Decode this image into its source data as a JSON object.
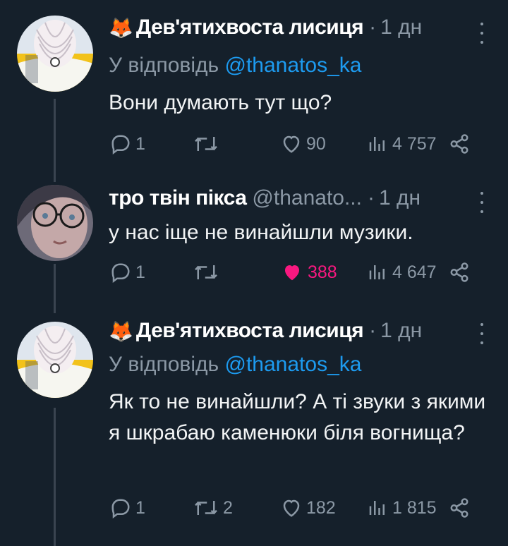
{
  "tweets": [
    {
      "name": "Дев'ятихвоста лисиця",
      "emoji": "🦊",
      "time": "1 дн",
      "reply_prefix": "У відповідь",
      "reply_mention": "@thanatos_ka",
      "text": "Вони думають тут що?",
      "replies": "1",
      "retweets": "",
      "likes": "90",
      "views": "4 757",
      "liked": false
    },
    {
      "name": "тро твін пікса",
      "handle": "@thanato...",
      "time": "1 дн",
      "text": "у нас іще не винайшли музики.",
      "replies": "1",
      "retweets": "",
      "likes": "388",
      "views": "4 647",
      "liked": true
    },
    {
      "name": "Дев'ятихвоста лисиця",
      "emoji": "🦊",
      "time": "1 дн",
      "reply_prefix": "У відповідь",
      "reply_mention": "@thanatos_ka",
      "text": "Як то не винайшли? А ті звуки з якими я шкрабаю каменюки біля вогнища?",
      "replies": "1",
      "retweets": "2",
      "likes": "182",
      "views": "1 815",
      "liked": false
    }
  ],
  "colors": {
    "background": "#15202b",
    "secondary_text": "#8b98a5",
    "link": "#1d9bf0",
    "like": "#f91880"
  },
  "icons": [
    "reply-icon",
    "retweet-icon",
    "like-icon",
    "views-icon",
    "share-icon",
    "more-icon"
  ]
}
